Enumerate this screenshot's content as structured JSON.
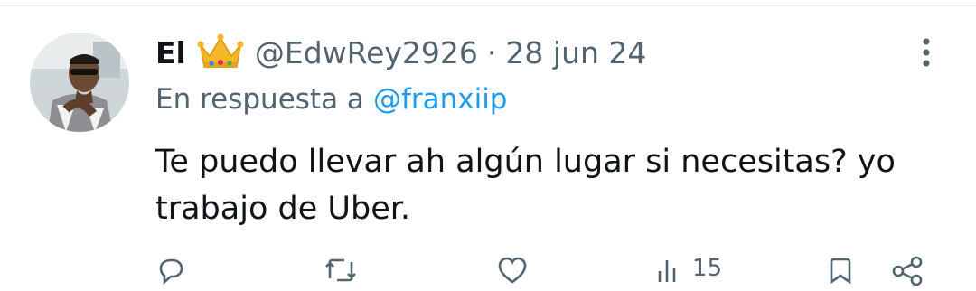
{
  "tweet": {
    "display_name": "El",
    "handle": "@EdwRey2926",
    "separator": "·",
    "date": "28 jun 24",
    "reply_prefix": "En respuesta a",
    "reply_to": "@franxiip",
    "text": "Te puedo llevar ah algún lugar si necesitas? yo trabajo de Uber.",
    "badge_icon": "crown-emoji",
    "colors": {
      "text": "#0f1419",
      "secondary": "#536471",
      "link": "#1d9bf0"
    }
  },
  "actions": {
    "reply_icon": "reply-icon",
    "retweet_icon": "retweet-icon",
    "like_icon": "like-icon",
    "views_icon": "views-icon",
    "views_count": "15",
    "bookmark_icon": "bookmark-icon",
    "share_icon": "share-icon"
  }
}
